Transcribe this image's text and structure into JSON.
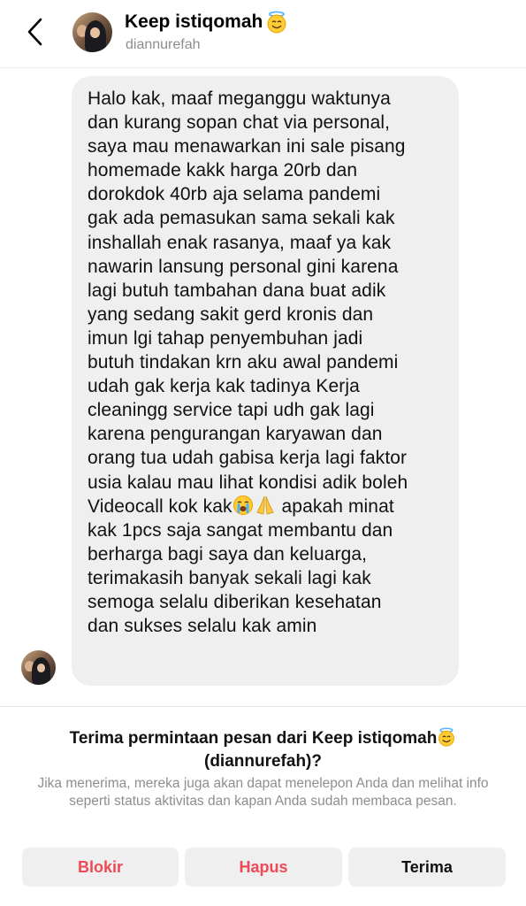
{
  "header": {
    "name": "Keep istiqomah",
    "name_emoji": "smiling-face-with-halo",
    "username": "diannurefah"
  },
  "message": {
    "text_part1": "Halo kak, maaf meganggu waktunya\ndan kurang sopan chat via personal,\nsaya mau menawarkan ini sale pisang\nhomemade kakk harga 20rb  dan\ndorokdok 40rb aja selama pandemi\ngak ada pemasukan sama sekali kak\ninshallah enak rasanya, maaf ya kak\nnawarin lansung personal gini karena\nlagi butuh tambahan dana buat adik\nyang sedang sakit gerd kronis dan\nimun lgi tahap penyembuhan jadi\nbutuh tindakan  krn aku awal pandemi\nudah gak kerja kak tadinya Kerja\ncleaningg service tapi udh gak lagi\nkarena pengurangan karyawan dan\norang tua udah gabisa kerja lagi faktor\nusia kalau mau lihat kondisi adik boleh\nVideocall kok kak",
    "emojis": [
      "loudly-crying-face",
      "folded-hands"
    ],
    "text_part2": " apakah minat\nkak 1pcs saja sangat membantu dan\nberharga bagi saya dan keluarga,\nterimakasih banyak sekali lagi kak\nsemoga selalu diberikan kesehatan\ndan sukses selalu kak amin"
  },
  "request": {
    "title_line1": "Terima permintaan pesan dari Keep istiqomah",
    "title_line2": "(diannurefah)?",
    "description": "Jika menerima, mereka juga akan dapat menelepon Anda dan melihat info seperti status aktivitas dan kapan Anda sudah membaca pesan."
  },
  "actions": {
    "block": "Blokir",
    "delete": "Hapus",
    "accept": "Terima"
  },
  "colors": {
    "danger": "#ed4956",
    "bubble": "#efefef",
    "secondary_text": "#8e8e8e"
  }
}
